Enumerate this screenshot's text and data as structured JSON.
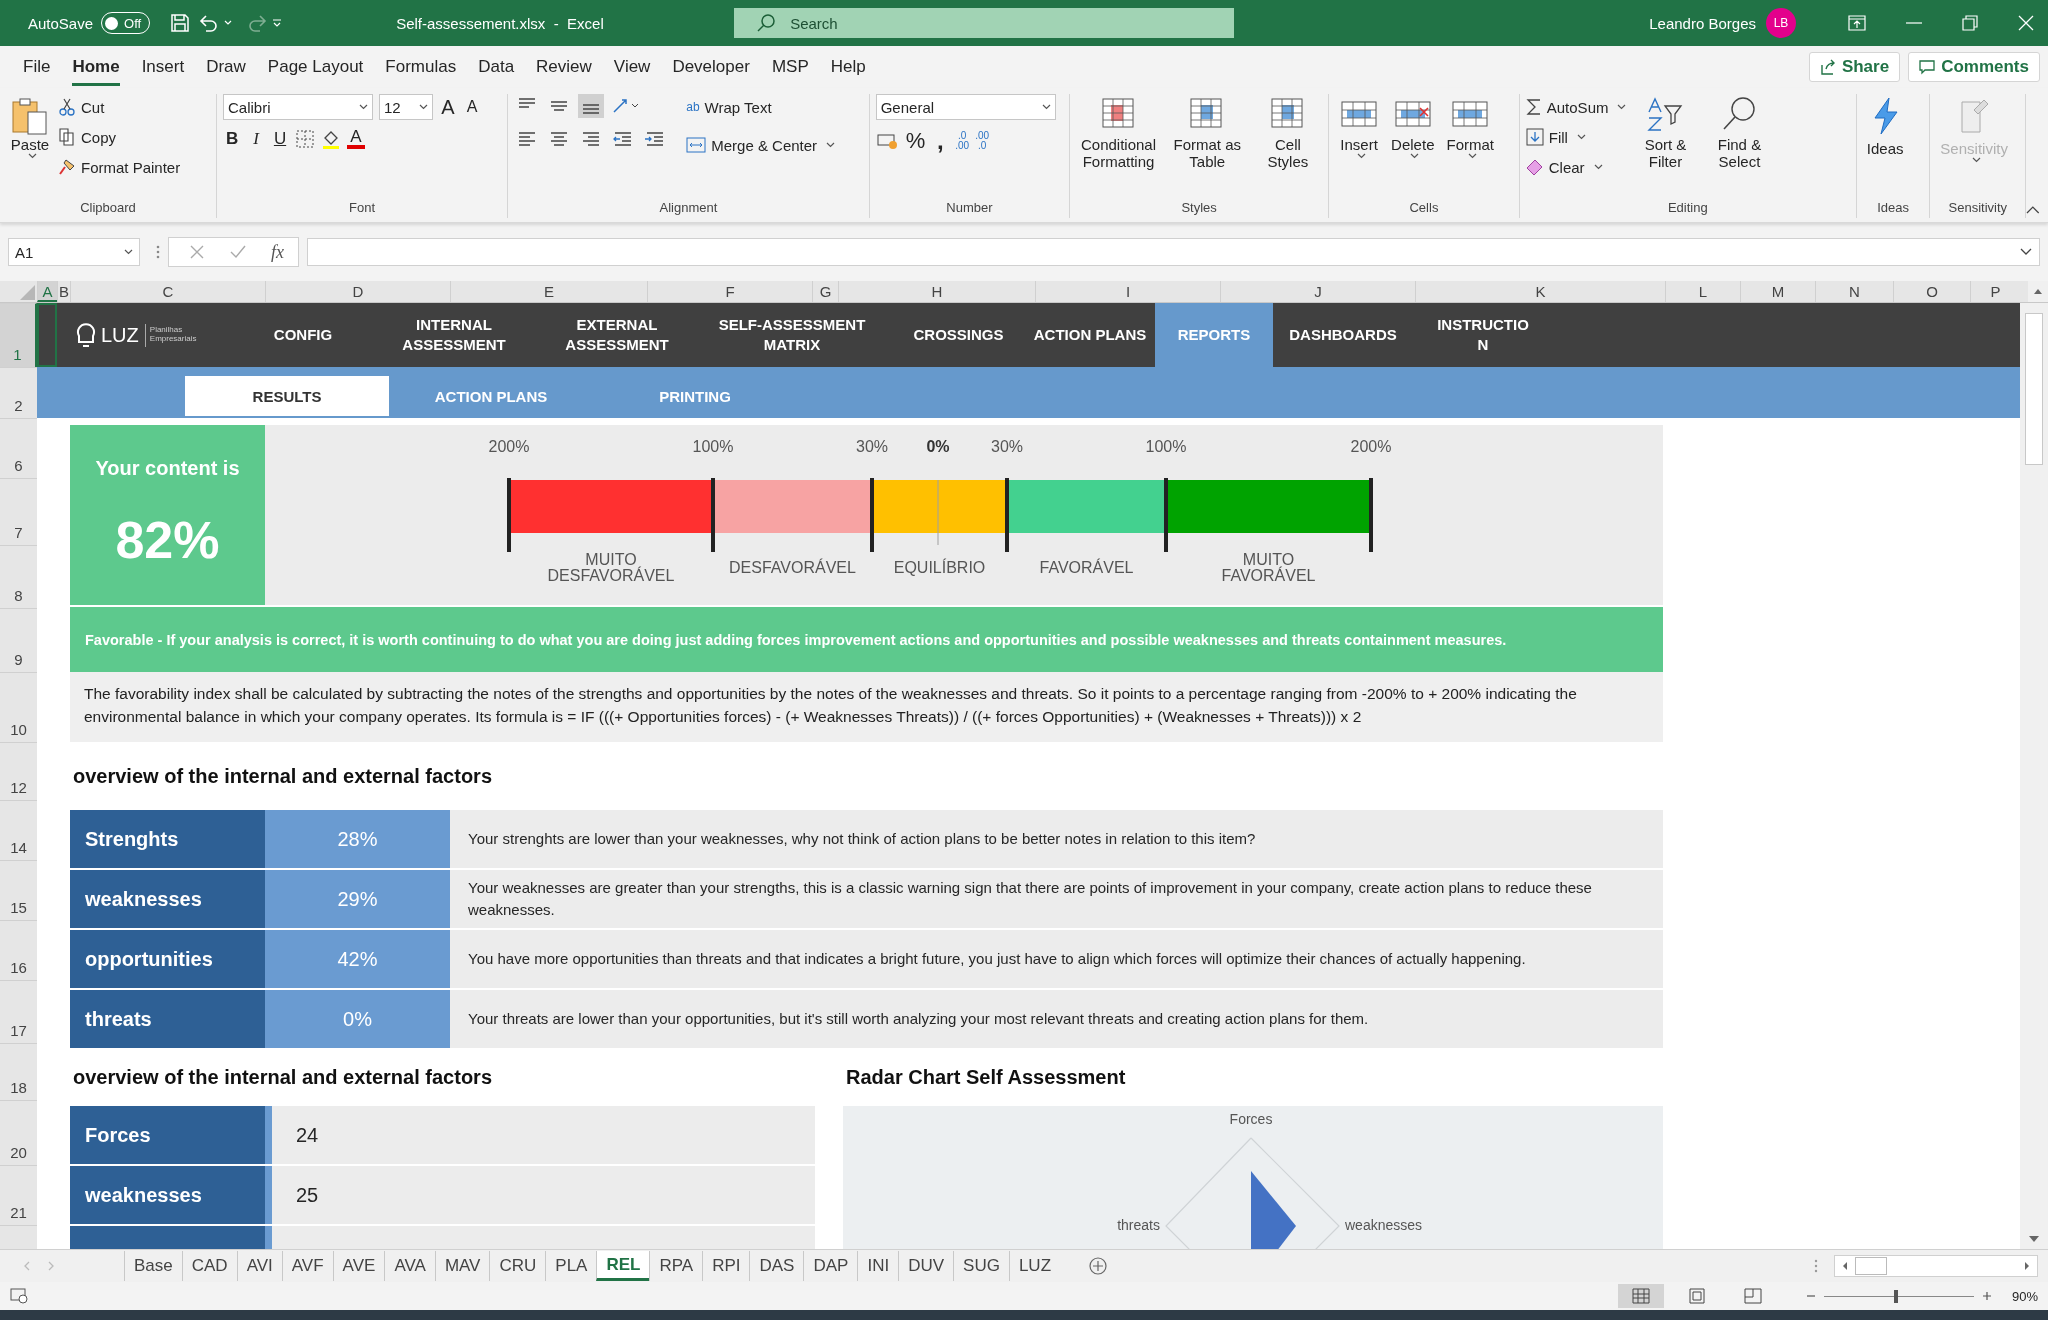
{
  "title_bar": {
    "autosave": "AutoSave",
    "toggle": {
      "on": false,
      "label": "Off"
    },
    "document": "Self-assessement.xlsx  -  Excel",
    "search": {
      "placeholder": "Search"
    },
    "user": "Leandro Borges",
    "initials": "LB"
  },
  "menu_tabs": [
    {
      "label": "File",
      "selected": false
    },
    {
      "label": "Home",
      "selected": true
    },
    {
      "label": "Insert",
      "selected": false
    },
    {
      "label": "Draw",
      "selected": false
    },
    {
      "label": "Page Layout",
      "selected": false
    },
    {
      "label": "Formulas",
      "selected": false
    },
    {
      "label": "Data",
      "selected": false
    },
    {
      "label": "Review",
      "selected": false
    },
    {
      "label": "View",
      "selected": false
    },
    {
      "label": "Developer",
      "selected": false
    },
    {
      "label": "MSP",
      "selected": false
    },
    {
      "label": "Help",
      "selected": false
    }
  ],
  "share": "Share",
  "comments": "Comments",
  "ribbon": {
    "clipboard": {
      "paste": "Paste",
      "cut": "Cut",
      "copy": "Copy",
      "format_painter": "Format Painter",
      "group": "Clipboard"
    },
    "font": {
      "name": "Calibri",
      "size": "12",
      "grow": "A",
      "shrink": "A",
      "bold": "B",
      "italic": "I",
      "underline": "U",
      "color_letter": "A",
      "group": "Font"
    },
    "alignment": {
      "wrap": "Wrap Text",
      "wrap_glyph": "ab",
      "merge": "Merge & Center",
      "group": "Alignment"
    },
    "number": {
      "format": "General",
      "percent": "%",
      "comma": ",",
      "increase_decimal": [
        ".0",
        ".00"
      ],
      "decrease_decimal": [
        ".00",
        ".0"
      ],
      "group": "Number"
    },
    "styles": {
      "buttons": [
        "Conditional Formatting",
        "Format as Table",
        "Cell Styles"
      ],
      "group": "Styles"
    },
    "cells": {
      "buttons": [
        "Insert",
        "Delete",
        "Format"
      ],
      "group": "Cells"
    },
    "editing": {
      "autosum": "AutoSum",
      "fill": "Fill",
      "clear": "Clear",
      "sort": "Sort & Filter",
      "find": "Find & Select",
      "group": "Editing"
    },
    "ideas": {
      "button": "Ideas",
      "group": "Ideas"
    },
    "sensitivity": {
      "button": "Sensitivity",
      "group": "Sensitivity",
      "disabled": true
    }
  },
  "formula_bar": {
    "name_box": "A1",
    "fx": "fx"
  },
  "columns": [
    "A",
    "B",
    "C",
    "D",
    "E",
    "F",
    "G",
    "H",
    "I",
    "J",
    "K",
    "L",
    "M",
    "N",
    "O",
    "P"
  ],
  "row_numbers": [
    "1",
    "2",
    "6",
    "7",
    "8",
    "9",
    "10",
    "12",
    "14",
    "15",
    "16",
    "17",
    "18",
    "20",
    "21"
  ],
  "nav": [
    {
      "label": "CONFIG",
      "selected": false
    },
    {
      "label": "INTERNAL ASSESSMENT",
      "selected": false
    },
    {
      "label": "EXTERNAL ASSESSMENT",
      "selected": false
    },
    {
      "label": "SELF-ASSESSMENT MATRIX",
      "selected": false
    },
    {
      "label": "CROSSINGS",
      "selected": false
    },
    {
      "label": "ACTION PLANS",
      "selected": false
    },
    {
      "label": "REPORTS",
      "selected": true
    },
    {
      "label": "DASHBOARDS",
      "selected": false
    },
    {
      "label": "INSTRUCTION",
      "selected": false
    }
  ],
  "logo": {
    "name": "LUZ",
    "tagline": "Planilhas Empresariais"
  },
  "subnav": [
    {
      "label": "RESULTS",
      "selected": true
    },
    {
      "label": "ACTION PLANS",
      "selected": false
    },
    {
      "label": "PRINTING",
      "selected": false
    }
  ],
  "gauge": {
    "title": "Your content is",
    "value": "82%",
    "scale": [
      "200%",
      "100%",
      "30%",
      "0%",
      "30%",
      "100%",
      "200%"
    ],
    "segments": [
      {
        "label": "MUITO DESFAVORÁVEL",
        "color": "#ff3030"
      },
      {
        "label": "DESFAVORÁVEL",
        "color": "#f7a3a3"
      },
      {
        "label": "EQUILÍBRIO",
        "color": "#ffc000"
      },
      {
        "label": "FAVORÁVEL",
        "color": "#43d18f"
      },
      {
        "label": "MUITO FAVORÁVEL",
        "color": "#00a300"
      }
    ]
  },
  "verdict": "Favorable - If your analysis is correct, it is worth continuing to do what you are doing just adding forces improvement actions and opportunities and possible weaknesses and threats containment measures.",
  "explanation": "The favorability index shall be calculated by subtracting the notes of the strengths and opportunities by the notes of the weaknesses and threats. So it points to a percentage ranging from -200% to + 200% indicating the environmental balance in which your company operates. Its formula is = IF (((+ Opportunities forces) - (+ Weaknesses Threats)) / ((+ forces Opportunities) + (Weaknesses + Threats))) x 2",
  "factors_heading": "overview of the internal and external factors",
  "factors": [
    {
      "label": "Strenghts",
      "percent": "28%",
      "text": "Your strenghts are lower than your weaknesses, why not think of action plans to be better notes in relation to this item?"
    },
    {
      "label": "weaknesses",
      "percent": "29%",
      "text": "Your weaknesses are greater than your strengths, this is a classic warning sign that there are points of improvement in your company, create action plans to reduce these weaknesses."
    },
    {
      "label": "opportunities",
      "percent": "42%",
      "text": "You have more opportunities than threats and that indicates a bright future, you just have to align which forces will optimize their chances of actually happening."
    },
    {
      "label": "threats",
      "percent": "0%",
      "text": "Your threats are lower than your opportunities, but it's still worth analyzing your most relevant threats and creating action plans for them."
    }
  ],
  "counts_heading": "overview of the internal and external factors",
  "counts": [
    {
      "label": "Forces",
      "value": "24"
    },
    {
      "label": "weaknesses",
      "value": "25"
    }
  ],
  "radar": {
    "title": "Radar Chart Self Assessment",
    "axis_labels": [
      "Forces",
      "weaknesses",
      "threats"
    ]
  },
  "sheet_tabs": [
    {
      "label": "Base",
      "selected": false
    },
    {
      "label": "CAD",
      "selected": false
    },
    {
      "label": "AVI",
      "selected": false
    },
    {
      "label": "AVF",
      "selected": false
    },
    {
      "label": "AVE",
      "selected": false
    },
    {
      "label": "AVA",
      "selected": false
    },
    {
      "label": "MAV",
      "selected": false
    },
    {
      "label": "CRU",
      "selected": false
    },
    {
      "label": "PLA",
      "selected": false
    },
    {
      "label": "REL",
      "selected": true
    },
    {
      "label": "RPA",
      "selected": false
    },
    {
      "label": "RPI",
      "selected": false
    },
    {
      "label": "DAS",
      "selected": false
    },
    {
      "label": "DAP",
      "selected": false
    },
    {
      "label": "INI",
      "selected": false
    },
    {
      "label": "DUV",
      "selected": false
    },
    {
      "label": "SUG",
      "selected": false
    },
    {
      "label": "LUZ",
      "selected": false
    }
  ],
  "status_bar": {
    "zoom": "90%",
    "zoom_slider": {
      "level": 0.47
    }
  }
}
